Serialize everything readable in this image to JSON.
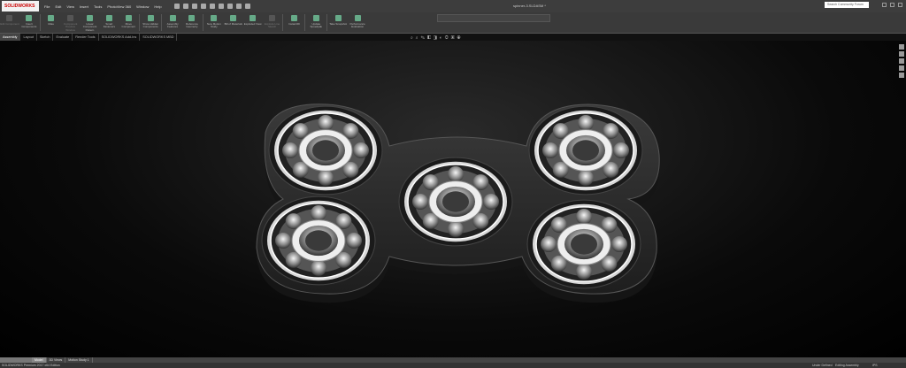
{
  "app": {
    "logo": "SOLIDWORKS",
    "doc_title": "spinner-3.SLDASM *",
    "search_placeholder": "Search Community Forum"
  },
  "menu": [
    "File",
    "Edit",
    "View",
    "Insert",
    "Tools",
    "PhotoView 360",
    "Window",
    "Help"
  ],
  "ribbon": [
    {
      "label": "Edit Component",
      "disabled": true
    },
    {
      "label": "Insert Components",
      "disabled": false
    },
    {
      "label": "Mate",
      "disabled": false
    },
    {
      "label": "Component Preview Window",
      "disabled": true
    },
    {
      "label": "Linear Component Pattern",
      "disabled": false
    },
    {
      "label": "Smart Fasteners",
      "disabled": false
    },
    {
      "label": "Move Component",
      "disabled": false
    },
    {
      "label": "Show Hidden Components",
      "disabled": false
    },
    {
      "label": "Assembly Features",
      "disabled": false
    },
    {
      "label": "Reference Geometry",
      "disabled": false
    },
    {
      "label": "New Motion Study",
      "disabled": false
    },
    {
      "label": "Bill of Materials",
      "disabled": false
    },
    {
      "label": "Exploded View",
      "disabled": false
    },
    {
      "label": "Explode Line Sketch",
      "disabled": true
    },
    {
      "label": "Instant3D",
      "disabled": false
    },
    {
      "label": "Update Speedpak",
      "disabled": false
    },
    {
      "label": "Take Snapshot",
      "disabled": false
    },
    {
      "label": "Performance Evaluation",
      "disabled": false
    }
  ],
  "tabs": [
    {
      "label": "Assembly",
      "active": true
    },
    {
      "label": "Layout"
    },
    {
      "label": "Sketch"
    },
    {
      "label": "Evaluate"
    },
    {
      "label": "Render Tools"
    },
    {
      "label": "SOLIDWORKS Add-Ins"
    },
    {
      "label": "SOLIDWORKS MBD"
    }
  ],
  "bottom_tabs": [
    {
      "label": "Model",
      "active": true
    },
    {
      "label": "3D Views"
    },
    {
      "label": "Motion Study 1"
    }
  ],
  "status": {
    "edition": "SOLIDWORKS Premium 2017 x64 Edition",
    "state": "Under Defined",
    "mode": "Editing Assembly",
    "units": "IPS"
  },
  "colors": {
    "body": "#2e2e2e",
    "ring": "#e8e8e8",
    "accent": "#c00000"
  }
}
